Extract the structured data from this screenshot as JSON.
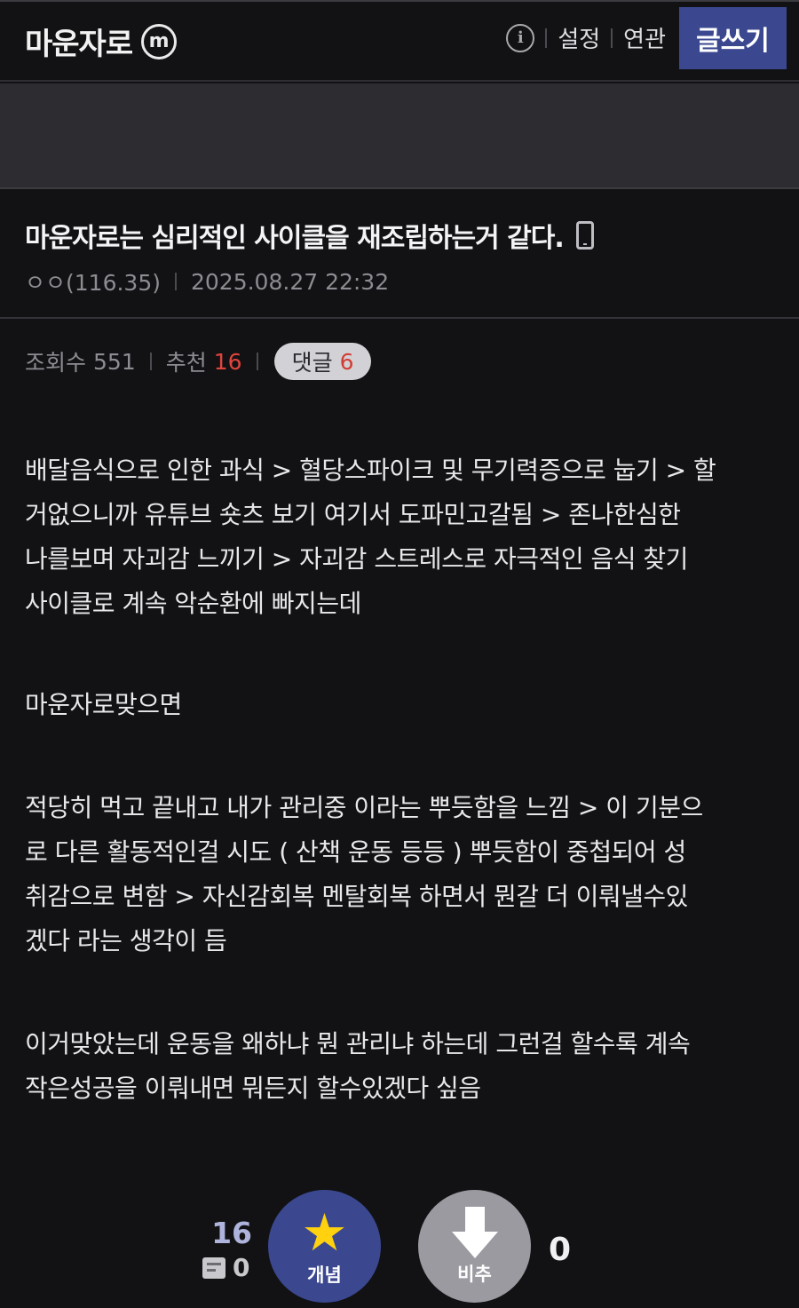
{
  "header": {
    "brand": "마운자로",
    "minor_badge": "m",
    "info_icon": "info-icon",
    "settings": "설정",
    "related": "연관",
    "write": "글쓰기"
  },
  "post": {
    "title": "마운자로는 심리적인 사이클을 재조립하는거 같다.",
    "author": "ㅇㅇ(116.35)",
    "date": "2025.08.27 22:32",
    "views_label": "조회수",
    "views": "551",
    "recommend_label": "추천",
    "recommend": "16",
    "comment_label": "댓글",
    "comments": "6"
  },
  "body": {
    "p1": [
      "배달음식으로 인한 과식 > 혈당스파이크 및 무기력증으로 눕기 > 할",
      "거없으니까 유튜브 숏츠 보기 여기서 도파민고갈됨 > 존나한심한",
      "나를보며 자괴감 느끼기 > 자괴감 스트레스로 자극적인 음식 찾기",
      "사이클로 계속 악순환에 빠지는데"
    ],
    "p2": [
      "마운자로맞으면"
    ],
    "p3": [
      "적당히 먹고 끝내고 내가 관리중 이라는 뿌듯함을 느낌 > 이 기분으",
      "로 다른 활동적인걸 시도 ( 산책 운동 등등 ) 뿌듯함이 중첩되어 성",
      "취감으로 변함 > 자신감회복 멘탈회복 하면서 뭔갈 더 이뤄낼수있",
      "겠다 라는 생각이 듬"
    ],
    "p4": [
      "이거맞았는데 운동을 왜하냐 뭔 관리냐 하는데 그런걸 할수록 계속",
      "작은성공을 이뤄내면 뭐든지 할수있겠다 싶음"
    ]
  },
  "vote": {
    "up_count": "16",
    "fix_count": "0",
    "up_label": "개념",
    "down_label": "비추",
    "down_count": "0"
  },
  "colors": {
    "accent": "#3b4890",
    "highlight": "#e0443d",
    "star": "#ffd10f"
  }
}
